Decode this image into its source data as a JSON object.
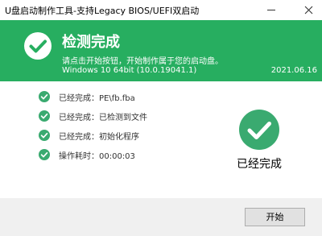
{
  "window": {
    "title": "U盘启动制作工具-支持Legacy BIOS/UEFI双启动"
  },
  "banner": {
    "title": "检测完成",
    "subtitle": "请点击开始按钮，开始制作属于您的启动盘。",
    "os": "Windows 10 64bit (10.0.19041.1)",
    "date": "2021.06.16"
  },
  "steps": [
    {
      "text": "已经完成：PE\\fb.fba"
    },
    {
      "text": "已经完成：已检测到文件"
    },
    {
      "text": "已经完成：初始化程序"
    },
    {
      "text": "操作耗时：00:00:03"
    }
  ],
  "status": {
    "label": "已经完成"
  },
  "buttons": {
    "start": "开始"
  },
  "colors": {
    "accent": "#27ae60",
    "icon_green": "#3aaa70"
  }
}
